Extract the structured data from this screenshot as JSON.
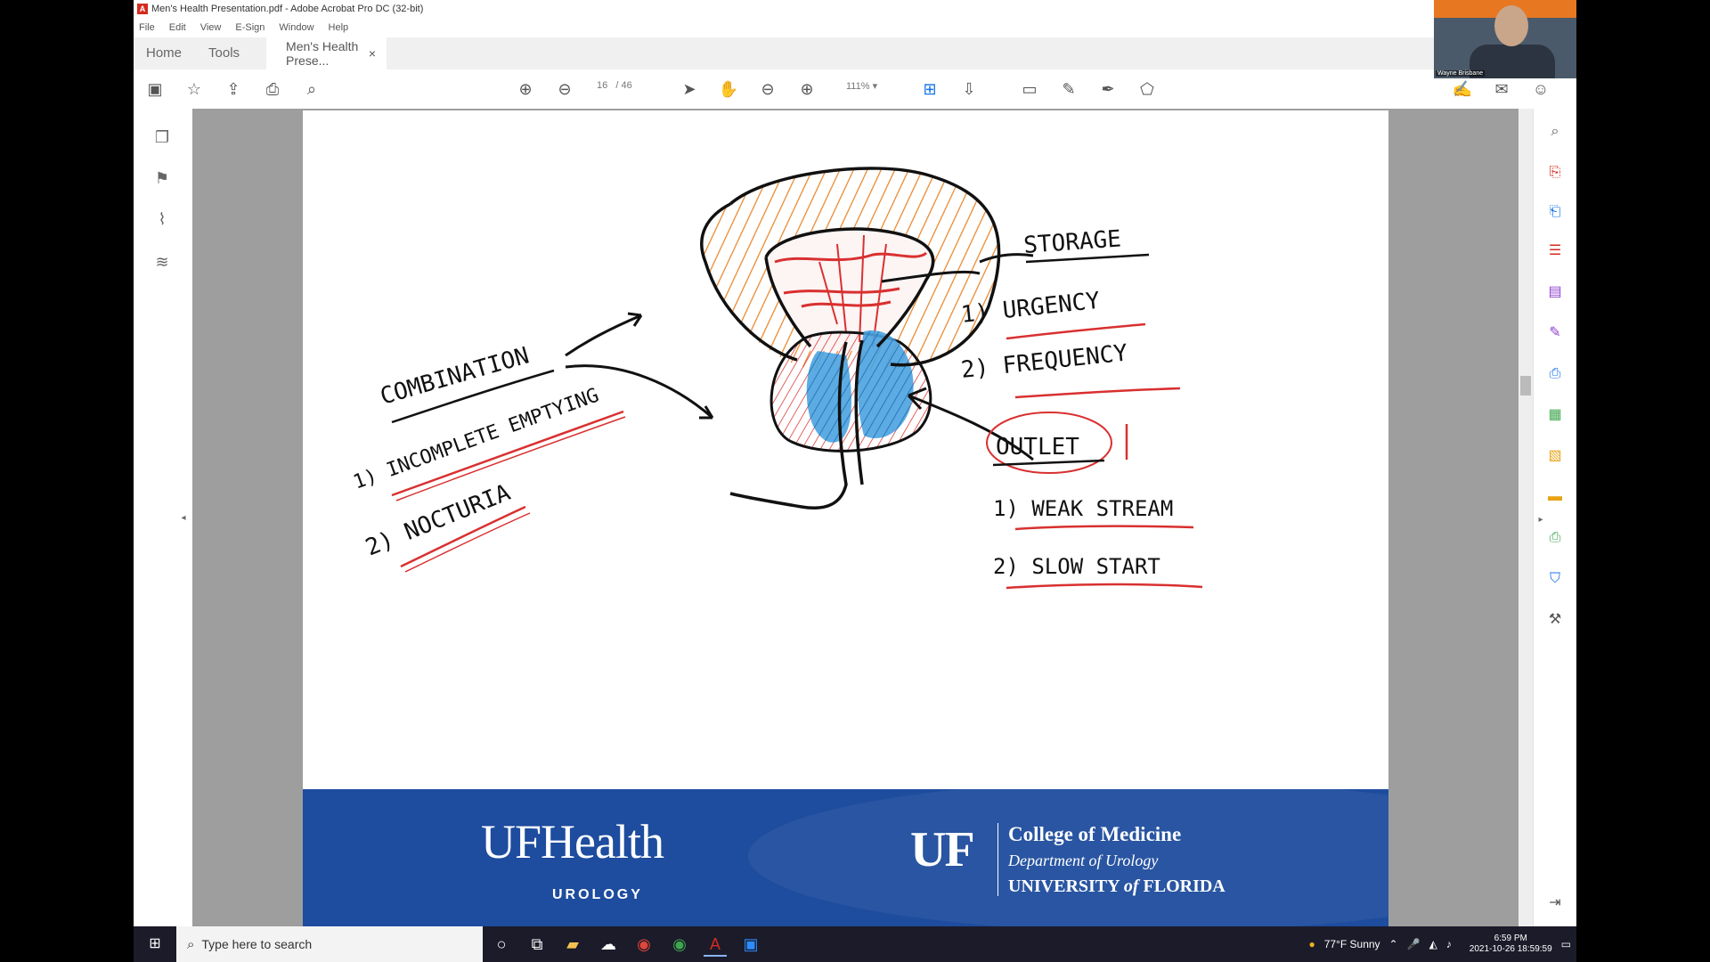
{
  "window": {
    "title": "Men's Health Presentation.pdf - Adobe Acrobat Pro DC (32-bit)"
  },
  "menu": [
    "File",
    "Edit",
    "View",
    "E-Sign",
    "Window",
    "Help"
  ],
  "tabs": {
    "home": "Home",
    "tools": "Tools",
    "document": "Men's Health Prese...",
    "close": "×"
  },
  "toolbar": {
    "page_current": "16",
    "page_total": "/ 46",
    "zoom": "111%"
  },
  "webcam": {
    "name": "Wayne Brisbane"
  },
  "drawing": {
    "combination": {
      "heading": "COMBINATION",
      "item1": "1) INCOMPLETE EMPTYING",
      "item2": "2) NOCTURIA"
    },
    "storage": {
      "heading": "STORAGE",
      "item1": "1) URGENCY",
      "item2": "2) FREQUENCY"
    },
    "outlet": {
      "heading": "OUTLET",
      "item1": "1) WEAK STREAM",
      "item2": "2) SLOW START"
    }
  },
  "footer": {
    "brand": "UFHealth",
    "brand_sub": "UROLOGY",
    "uf": "UF",
    "college": "College of Medicine",
    "department": "Department of Urology",
    "university_a": "UNIVERSITY",
    "university_of": "of",
    "university_b": "FLORIDA"
  },
  "taskbar": {
    "search_placeholder": "Type here to search",
    "weather": "77°F  Sunny",
    "time": "6:59 PM",
    "date": "2021-10-26 18:59:59"
  },
  "colors": {
    "acrobat_red": "#d52b1e",
    "acrobat_blue": "#1473e6",
    "uf_blue": "#1e4c9e",
    "ink_orange": "#e8862c",
    "ink_red": "#d93030",
    "ink_blue": "#2f8fd8"
  }
}
